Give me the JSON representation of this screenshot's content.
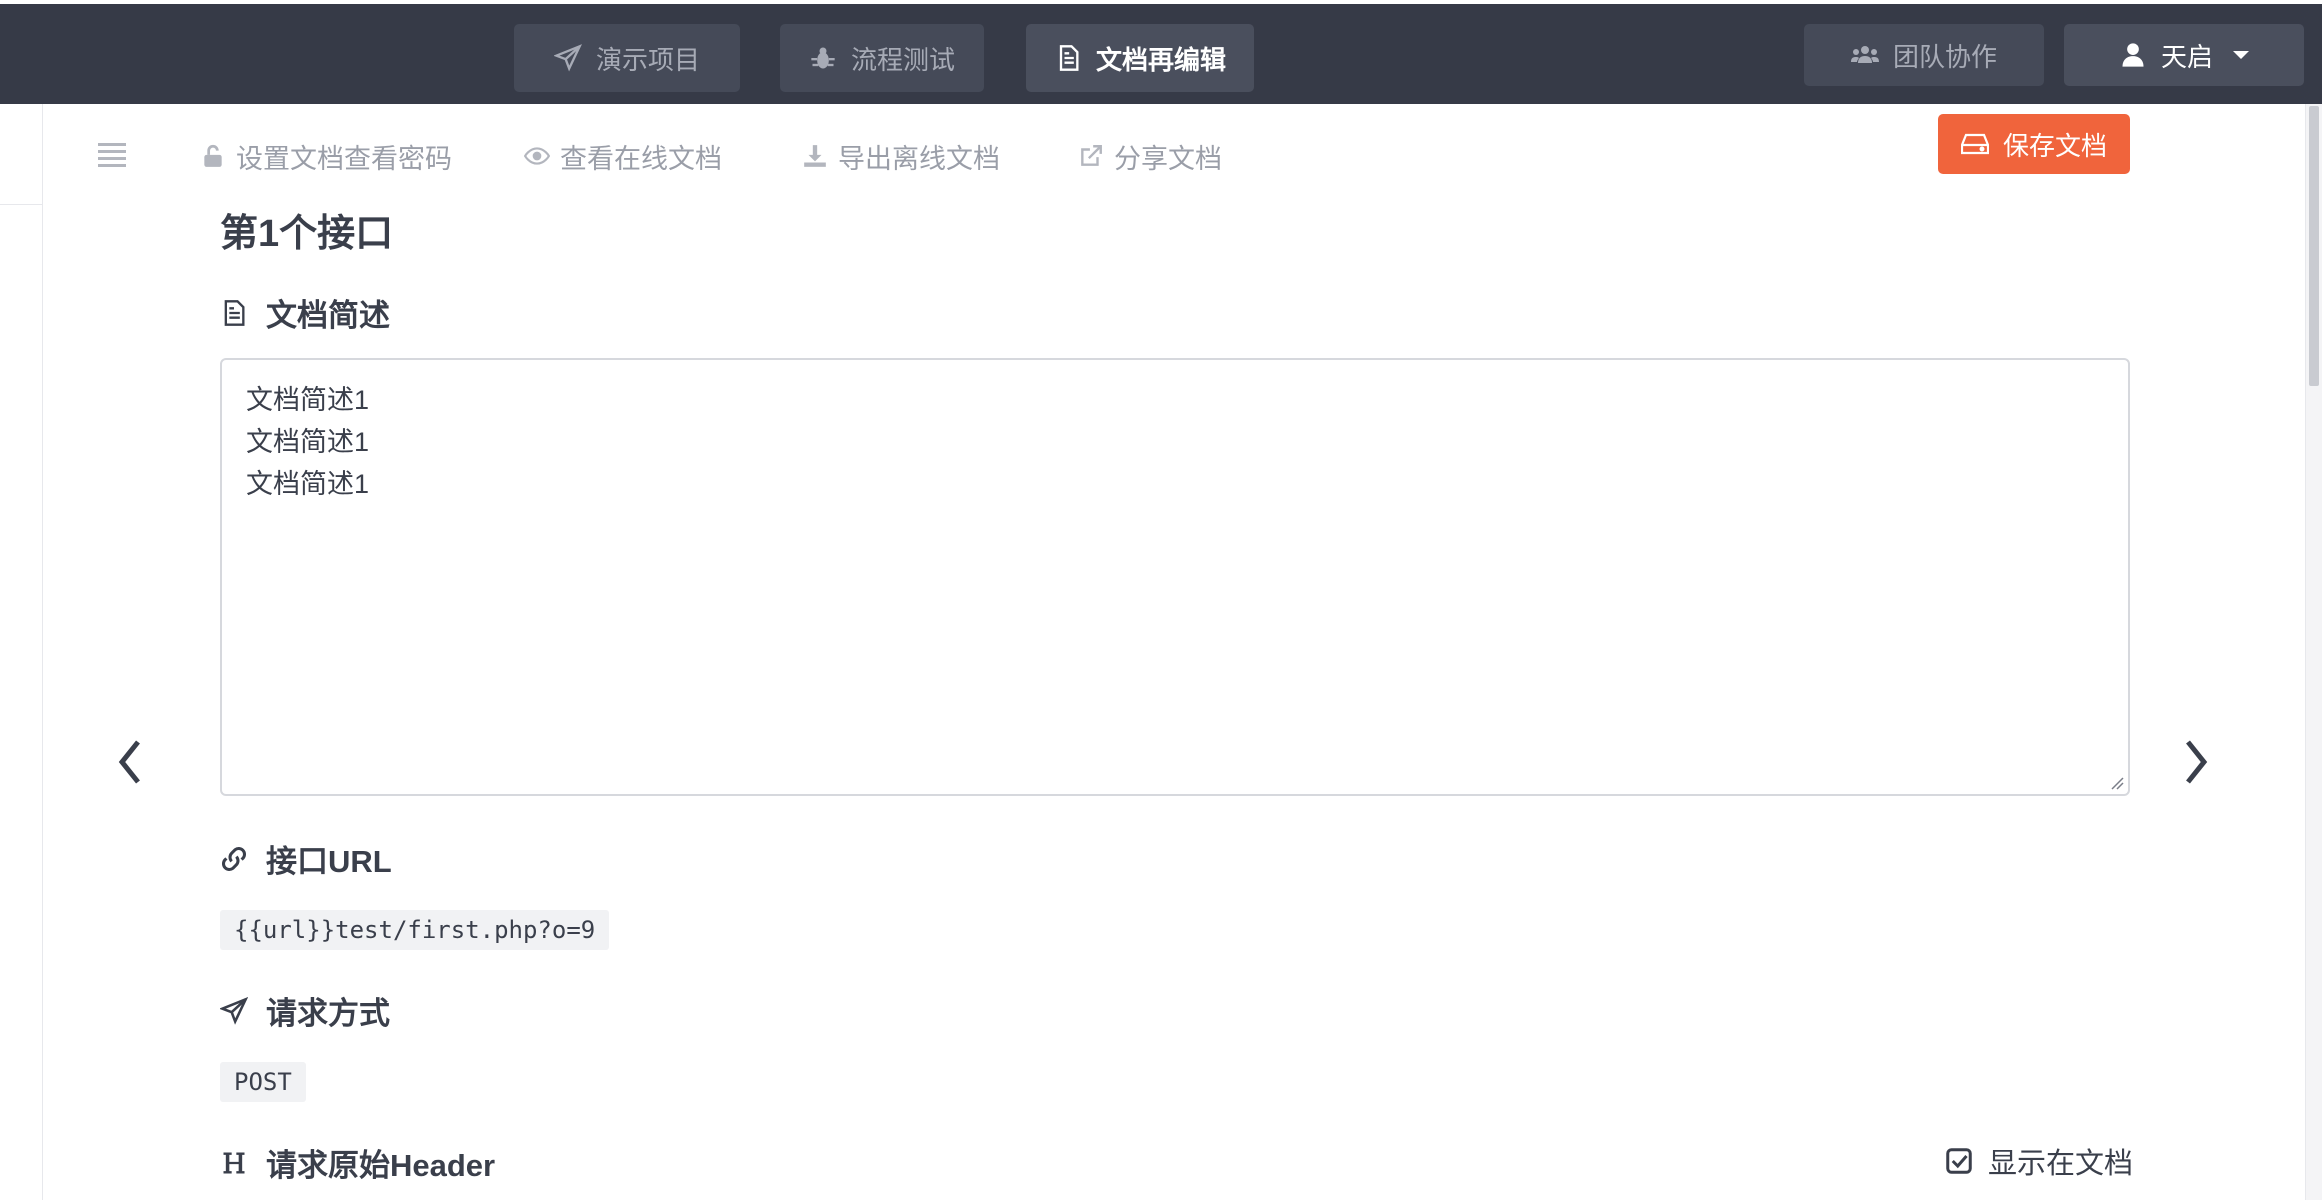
{
  "nav": {
    "demo_project": "演示项目",
    "flow_test": "流程测试",
    "doc_reedit": "文档再编辑",
    "team": "团队协作",
    "user": "天启"
  },
  "toolbar": {
    "set_password": "设置文档查看密码",
    "view_online": "查看在线文档",
    "export_offline": "导出离线文档",
    "share": "分享文档",
    "save": "保存文档"
  },
  "doc": {
    "title": "第1个接口",
    "summary_heading": "文档简述",
    "summary_lines": [
      "文档简述1",
      "文档简述1",
      "文档简述1"
    ],
    "url_heading": "接口URL",
    "url_value": "{{url}}test/first.php?o=9",
    "method_heading": "请求方式",
    "method_value": "POST",
    "header_heading": "请求原始Header",
    "show_in_doc": "显示在文档"
  },
  "icons": {
    "demo": "paper-plane-icon",
    "flow": "bug-icon",
    "doc": "file-icon",
    "team": "users-icon",
    "user": "user-icon",
    "lock": "unlock-icon",
    "eye": "eye-icon",
    "download": "download-icon",
    "share": "external-link-icon",
    "save": "hdd-icon",
    "link": "link-icon",
    "header": "header-icon",
    "check": "check-square-icon"
  },
  "colors": {
    "navbar": "#363a47",
    "accent": "#f0643c",
    "text": "#3a3f4b",
    "muted": "#9a9ea8"
  }
}
